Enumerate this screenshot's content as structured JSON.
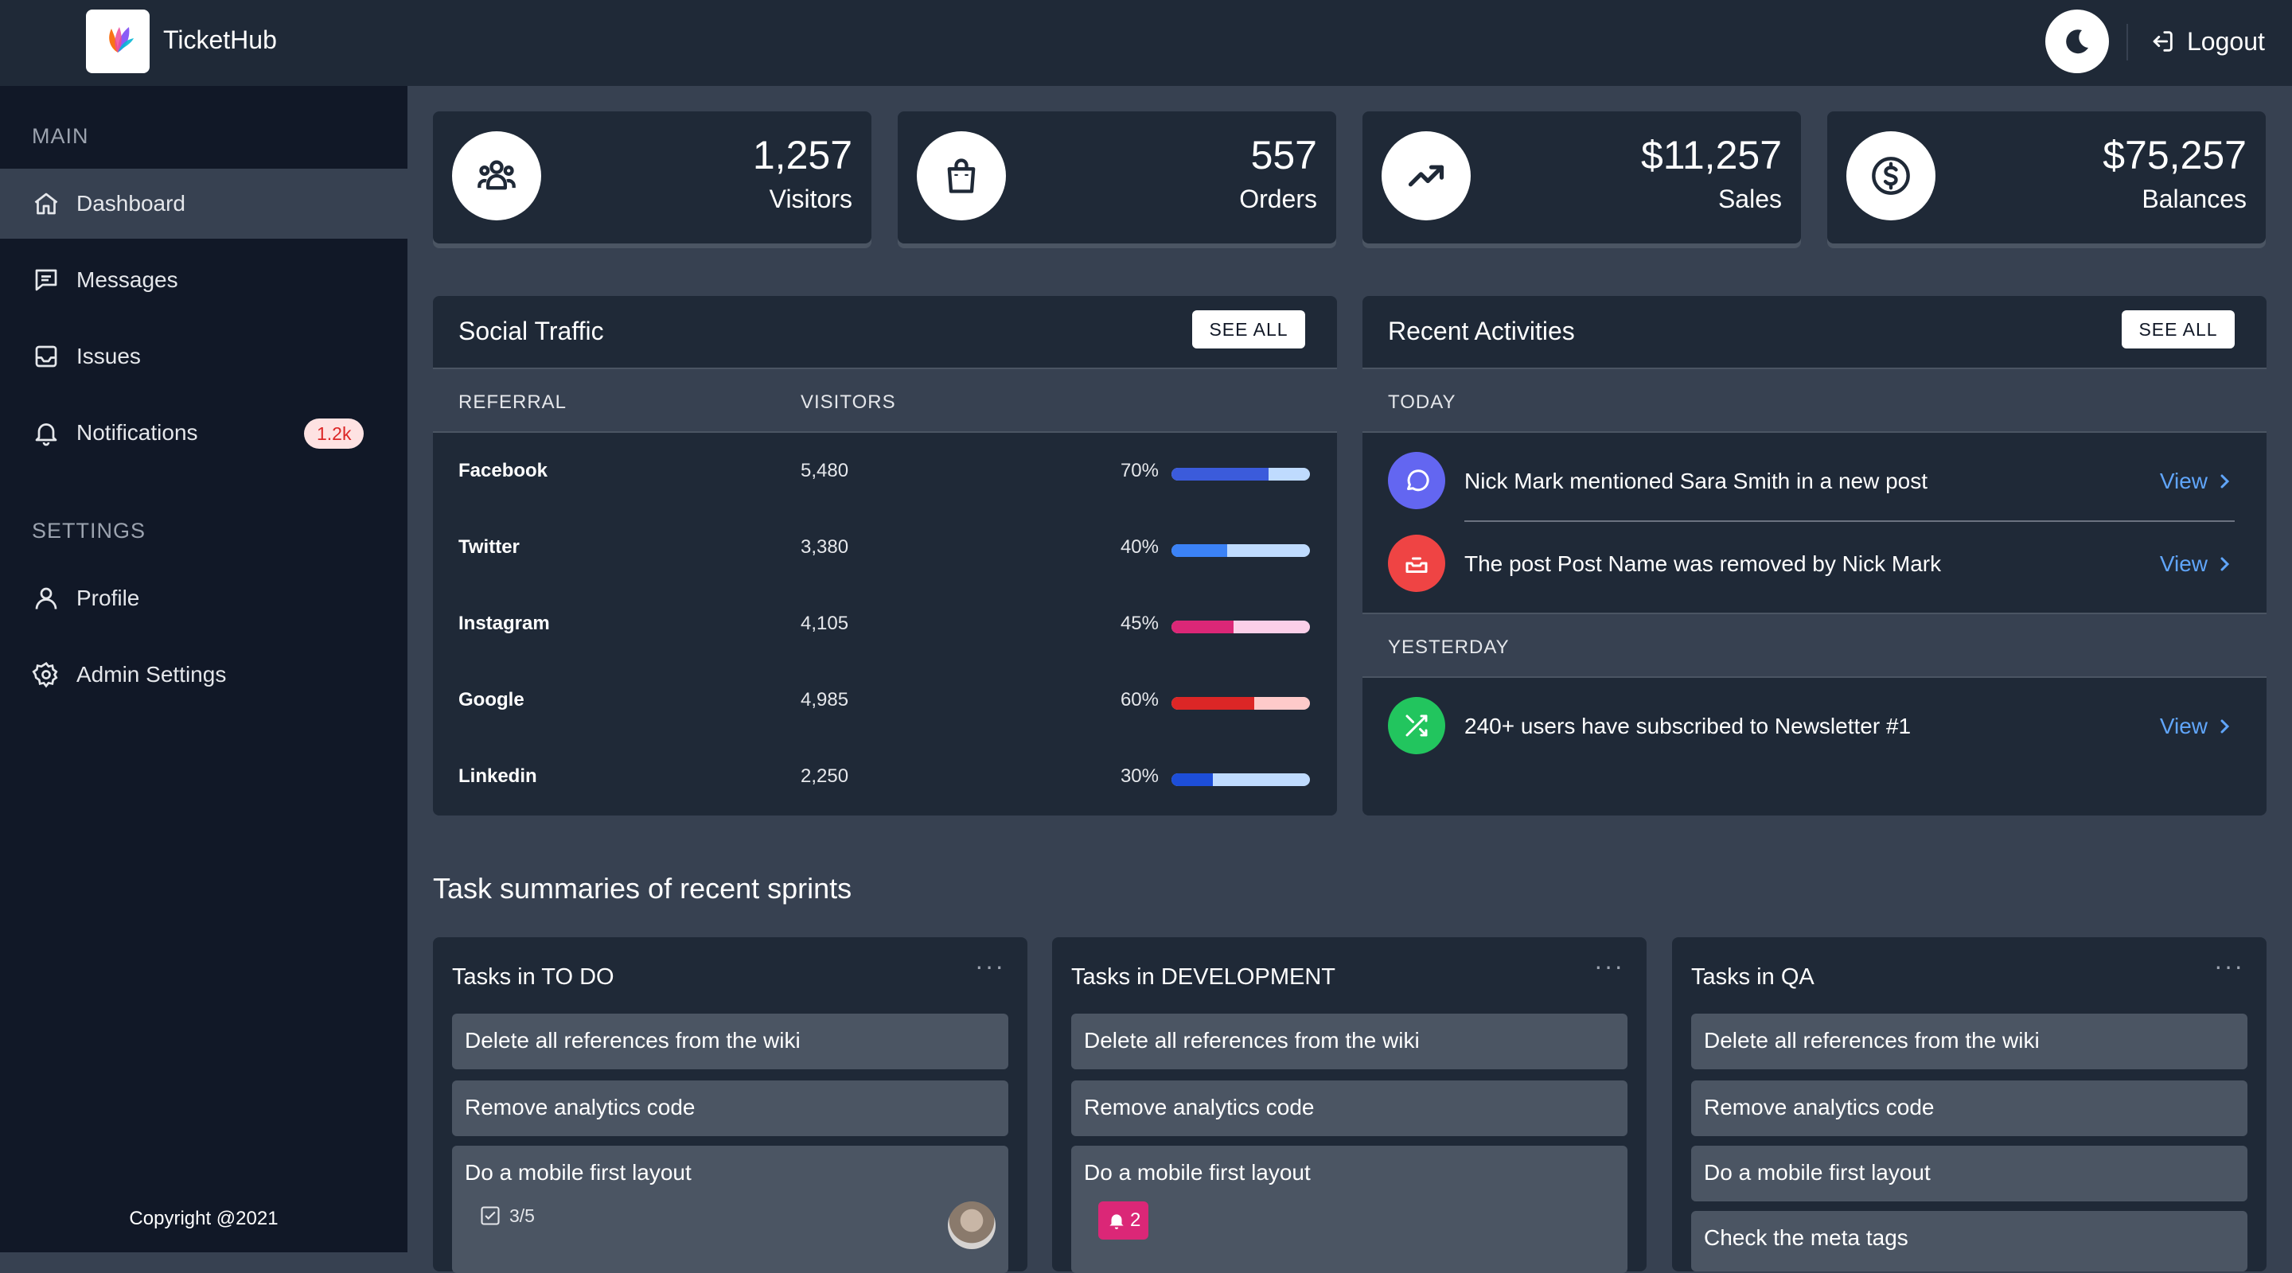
{
  "app": {
    "title": "TicketHub",
    "logout_label": "Logout"
  },
  "sidebar": {
    "sections": [
      {
        "label": "MAIN"
      },
      {
        "label": "SETTINGS"
      }
    ],
    "items": [
      {
        "label": "Dashboard",
        "icon": "home-icon",
        "active": true
      },
      {
        "label": "Messages",
        "icon": "message-icon"
      },
      {
        "label": "Issues",
        "icon": "inbox-icon"
      },
      {
        "label": "Notifications",
        "icon": "bell-icon",
        "badge": "1.2k"
      },
      {
        "label": "Profile",
        "icon": "user-icon"
      },
      {
        "label": "Admin Settings",
        "icon": "gear-icon"
      }
    ],
    "copyright": "Copyright @2021"
  },
  "stats": [
    {
      "value": "1,257",
      "label": "Visitors",
      "icon": "users-icon"
    },
    {
      "value": "557",
      "label": "Orders",
      "icon": "shopping-bag-icon"
    },
    {
      "value": "$11,257",
      "label": "Sales",
      "icon": "trending-up-icon"
    },
    {
      "value": "$75,257",
      "label": "Balances",
      "icon": "dollar-icon"
    }
  ],
  "social_traffic": {
    "title": "Social Traffic",
    "see_all": "SEE ALL",
    "columns": [
      "REFERRAL",
      "VISITORS"
    ],
    "rows": [
      {
        "name": "Facebook",
        "visitors": "5,480",
        "percent_label": "70%",
        "percent": 70,
        "fill": "#3b5bdb",
        "track": "#bfdbfe"
      },
      {
        "name": "Twitter",
        "visitors": "3,380",
        "percent_label": "40%",
        "percent": 40,
        "fill": "#3b82f6",
        "track": "#bfdbfe"
      },
      {
        "name": "Instagram",
        "visitors": "4,105",
        "percent_label": "45%",
        "percent": 45,
        "fill": "#db2777",
        "track": "#fbcfe8"
      },
      {
        "name": "Google",
        "visitors": "4,985",
        "percent_label": "60%",
        "percent": 60,
        "fill": "#dc2626",
        "track": "#fecaca"
      },
      {
        "name": "Linkedin",
        "visitors": "2,250",
        "percent_label": "30%",
        "percent": 30,
        "fill": "#1d4ed8",
        "track": "#bfdbfe"
      }
    ]
  },
  "recent_activities": {
    "title": "Recent Activities",
    "see_all": "SEE ALL",
    "groups": [
      {
        "label": "TODAY",
        "items": [
          {
            "text": "Nick Mark mentioned Sara Smith in a new post",
            "view": "View",
            "icon": "message-circle-icon",
            "color": "#6366f1"
          },
          {
            "text": "The post Post Name was removed by Nick Mark",
            "view": "View",
            "icon": "archive-icon",
            "color": "#ef4444"
          }
        ]
      },
      {
        "label": "YESTERDAY",
        "items": [
          {
            "text": "240+ users have subscribed to Newsletter #1",
            "view": "View",
            "icon": "shuffle-icon",
            "color": "#22c55e"
          }
        ]
      }
    ]
  },
  "tasks": {
    "title": "Task summaries of recent sprints",
    "boards": [
      {
        "title": "Tasks in TO DO",
        "menu": "···",
        "items": [
          {
            "text": "Delete all references from the wiki"
          },
          {
            "text": "Remove analytics code"
          },
          {
            "text": "Do a mobile first layout",
            "checklist": "3/5"
          }
        ]
      },
      {
        "title": "Tasks in DEVELOPMENT",
        "menu": "···",
        "items": [
          {
            "text": "Delete all references from the wiki"
          },
          {
            "text": "Remove analytics code"
          },
          {
            "text": "Do a mobile first layout",
            "notifications": "2"
          }
        ]
      },
      {
        "title": "Tasks in QA",
        "menu": "···",
        "items": [
          {
            "text": "Delete all references from the wiki"
          },
          {
            "text": "Remove analytics code"
          },
          {
            "text": "Do a mobile first layout"
          },
          {
            "text": "Check the meta tags"
          }
        ]
      }
    ]
  }
}
